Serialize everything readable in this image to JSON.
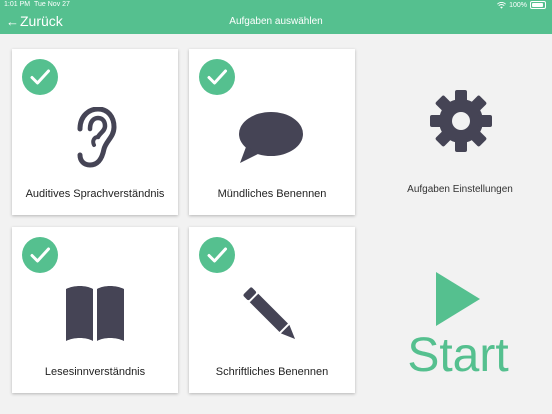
{
  "status": {
    "time": "1:01 PM",
    "date": "Tue Nov 27",
    "battery": "100%"
  },
  "nav": {
    "back_label": "Zurück",
    "title": "Aufgaben auswählen"
  },
  "cards": [
    {
      "label": "Auditives Sprachverständnis",
      "checked": true,
      "icon": "ear-icon"
    },
    {
      "label": "Mündliches Benennen",
      "checked": true,
      "icon": "speech-bubble-icon"
    },
    {
      "label": "Lesesinnverständnis",
      "checked": true,
      "icon": "book-icon"
    },
    {
      "label": "Schriftliches Benennen",
      "checked": true,
      "icon": "pencil-icon"
    }
  ],
  "settings": {
    "label": "Aufgaben Einstellungen",
    "icon": "gear-icon"
  },
  "start": {
    "label": "Start",
    "icon": "play-icon"
  },
  "colors": {
    "accent": "#55c08f",
    "icon_dark": "#454455",
    "background": "#f2f2f2"
  }
}
